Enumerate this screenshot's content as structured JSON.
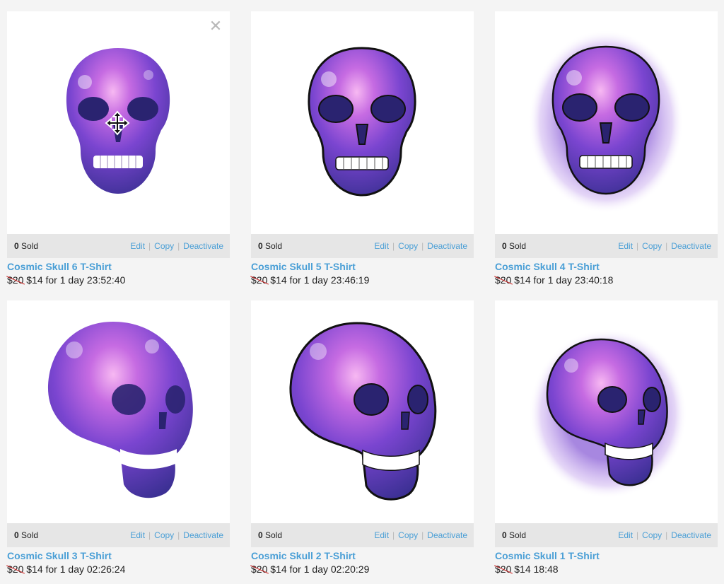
{
  "colors": {
    "link": "#4a9fd6",
    "bar": "#e6e6e6",
    "page_bg": "#f4f4f4",
    "galaxy_dark": "#3c3094",
    "galaxy_purple": "#8a49d8",
    "galaxy_pink": "#e37ad6",
    "strike": "#cc2b2b"
  },
  "products": [
    {
      "title": "Cosmic Skull 6 T-Shirt",
      "sold_count": "0",
      "sold_label": "Sold",
      "edit": "Edit",
      "copy": "Copy",
      "deactivate": "Deactivate",
      "old_price": "$20",
      "new_price": "$14",
      "timer": "for 1 day 23:52:40",
      "image": "galaxy-skull-front-plain"
    },
    {
      "title": "Cosmic Skull 5 T-Shirt",
      "sold_count": "0",
      "sold_label": "Sold",
      "edit": "Edit",
      "copy": "Copy",
      "deactivate": "Deactivate",
      "old_price": "$20",
      "new_price": "$14",
      "timer": "for 1 day 23:46:19",
      "image": "galaxy-skull-front-outlined"
    },
    {
      "title": "Cosmic Skull 4 T-Shirt",
      "sold_count": "0",
      "sold_label": "Sold",
      "edit": "Edit",
      "copy": "Copy",
      "deactivate": "Deactivate",
      "old_price": "$20",
      "new_price": "$14",
      "timer": "for 1 day 23:40:18",
      "image": "galaxy-skull-front-splash"
    },
    {
      "title": "Cosmic Skull 3 T-Shirt",
      "sold_count": "0",
      "sold_label": "Sold",
      "edit": "Edit",
      "copy": "Copy",
      "deactivate": "Deactivate",
      "old_price": "$20",
      "new_price": "$14",
      "timer": "for 1 day 02:26:24",
      "image": "galaxy-skull-side-plain"
    },
    {
      "title": "Cosmic Skull 2 T-Shirt",
      "sold_count": "0",
      "sold_label": "Sold",
      "edit": "Edit",
      "copy": "Copy",
      "deactivate": "Deactivate",
      "old_price": "$20",
      "new_price": "$14",
      "timer": "for 1 day 02:20:29",
      "image": "galaxy-skull-side-outlined"
    },
    {
      "title": "Cosmic Skull 1 T-Shirt",
      "sold_count": "0",
      "sold_label": "Sold",
      "edit": "Edit",
      "copy": "Copy",
      "deactivate": "Deactivate",
      "old_price": "$20",
      "new_price": "$14",
      "timer": "18:48",
      "image": "galaxy-skull-side-splash"
    }
  ],
  "overlay": {
    "close_icon": "close-icon",
    "cursor_icon": "move-cursor-icon"
  }
}
